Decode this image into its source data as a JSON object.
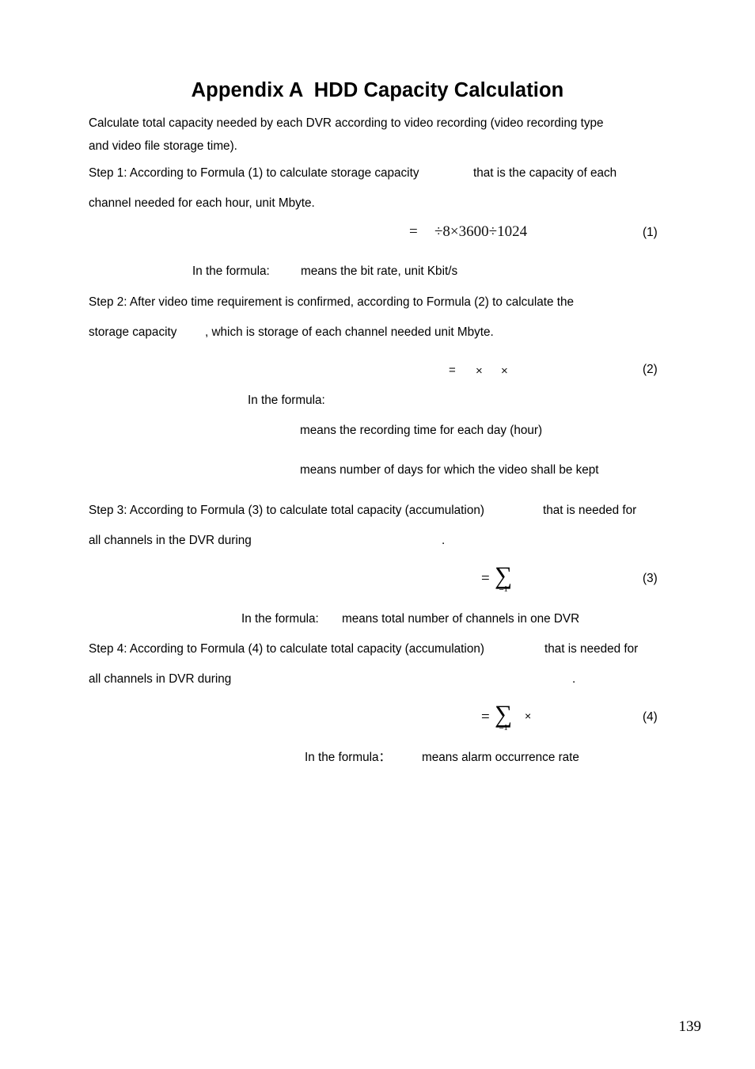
{
  "document": {
    "title": "Appendix A  HDD Capacity Calculation",
    "page_number": "139"
  },
  "intro": {
    "line1": "Calculate total capacity needed by each DVR according to video recording (video recording type",
    "line2": "and video file storage time)."
  },
  "steps": [
    {
      "id": "step-1",
      "line1_before": "Step 1: According to Formula (1) to calculate storage capacity",
      "line1_after": "that is the capacity of each",
      "line2": "channel needed for each hour, unit Mbyte."
    },
    {
      "id": "step-2",
      "line1": "Step 2: After video time requirement is confirmed, according to Formula (2) to calculate the",
      "line2_before": "storage capacity",
      "line2_after": ", which is storage of each channel needed unit Mbyte."
    },
    {
      "id": "step-3",
      "line1_before": "Step 3: According to Formula (3) to calculate total capacity (accumulation)",
      "line1_after": "that is needed for",
      "line2_before": "all channels in the DVR during",
      "line2_after": "."
    },
    {
      "id": "step-4",
      "line1_before": "Step 4: According to Formula (4) to calculate total capacity (accumulation)",
      "line1_after": "that is needed for",
      "line2_before": "all channels in DVR during",
      "line2_after": "."
    }
  ],
  "formulas": [
    {
      "id": "formula-1",
      "equals": "=",
      "expression": "÷8×3600÷1024",
      "number": "(1)"
    },
    {
      "id": "formula-2",
      "equals": "=",
      "operator_1": "×",
      "operator_2": "×",
      "number": "(2)"
    },
    {
      "id": "formula-3",
      "equals": "=",
      "sigma": "∑",
      "sigma_subscript": "=1",
      "number": "(3)"
    },
    {
      "id": "formula-4",
      "equals": "=",
      "sigma": "∑",
      "sigma_subscript": "=1",
      "operator_1": "×",
      "number": "(4)"
    }
  ],
  "notes": [
    {
      "id": "note-1",
      "label": "In the formula:",
      "text": "means the bit rate, unit Kbit/s"
    },
    {
      "id": "note-2",
      "label": "In the formula:",
      "text": ""
    },
    {
      "id": "note-2a",
      "label": "",
      "text": "means the recording time for each day (hour)"
    },
    {
      "id": "note-2b",
      "label": "",
      "text": "means number of days for which the video shall be kept"
    },
    {
      "id": "note-3",
      "label": "In the formula:",
      "text": "means total number of channels in one DVR"
    },
    {
      "id": "note-4",
      "label": "In the formula：",
      "text": "means alarm occurrence rate"
    }
  ]
}
